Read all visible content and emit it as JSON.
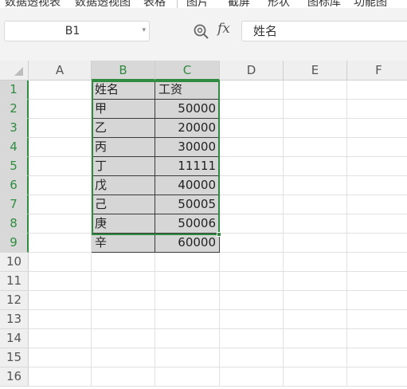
{
  "ribbon": {
    "items": [
      "数据透视表",
      "数据透视图",
      "表格",
      "图片",
      "截屏",
      "形状",
      "图标库",
      "功能图"
    ]
  },
  "formula_bar": {
    "name_box": "B1",
    "fx_label": "fx",
    "formula_value": "姓名"
  },
  "columns": [
    "A",
    "B",
    "C",
    "D",
    "E",
    "F"
  ],
  "selected_columns": [
    "B",
    "C"
  ],
  "rows": [
    "1",
    "2",
    "3",
    "4",
    "5",
    "6",
    "7",
    "8",
    "9",
    "10",
    "11",
    "12",
    "13",
    "14",
    "15",
    "16"
  ],
  "selected_rows": [
    "1",
    "2",
    "3",
    "4",
    "5",
    "6",
    "7",
    "8",
    "9"
  ],
  "table": {
    "header": {
      "name": "姓名",
      "salary": "工资"
    },
    "records": [
      {
        "name": "甲",
        "salary": "50000"
      },
      {
        "name": "乙",
        "salary": "20000"
      },
      {
        "name": "丙",
        "salary": "30000"
      },
      {
        "name": "丁",
        "salary": "11111"
      },
      {
        "name": "戊",
        "salary": "40000"
      },
      {
        "name": "己",
        "salary": "50005"
      },
      {
        "name": "庚",
        "salary": "50006"
      },
      {
        "name": "辛",
        "salary": "60000"
      }
    ]
  },
  "colors": {
    "selection_accent": "#2e8b3f",
    "filled_cell": "#d6d6d6",
    "header_bg": "#efefef"
  }
}
